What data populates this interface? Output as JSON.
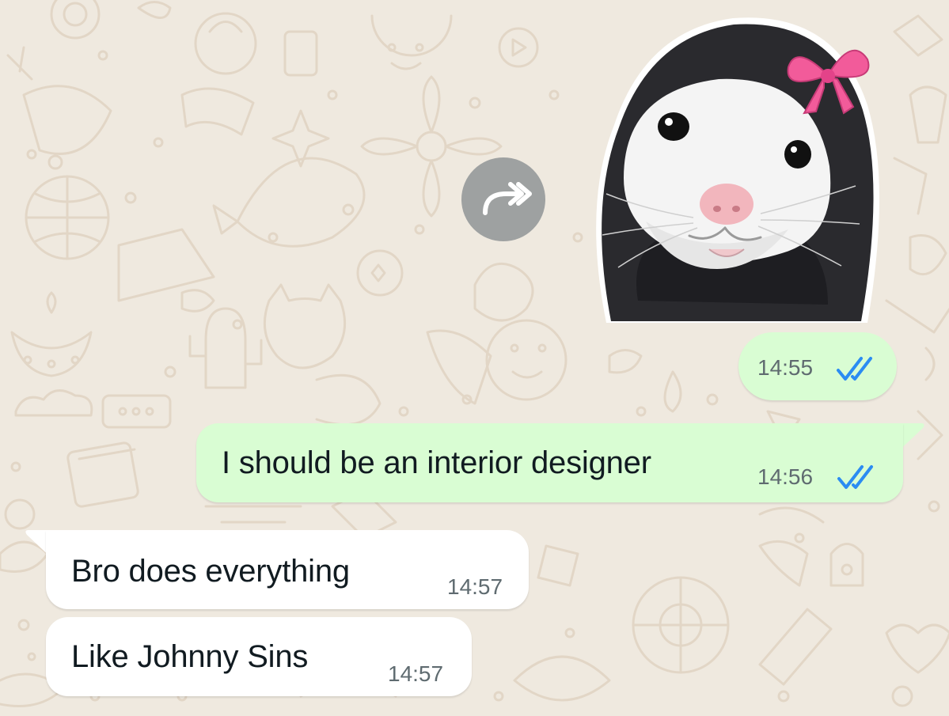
{
  "colors": {
    "wallpaper": "#efe9df",
    "outgoing_bubble": "#d9fdd3",
    "incoming_bubble": "#ffffff",
    "read_ticks": "#2b8cf2",
    "text": "#111b21",
    "timestamp": "#5f6b70"
  },
  "forward_button": {
    "icon": "forward-icon"
  },
  "sticker": {
    "description_icon": "hamster-sticker",
    "time": "14:55",
    "status_icon": "double-check-read-icon"
  },
  "messages": [
    {
      "direction": "outgoing",
      "text": "I should be an interior designer",
      "time": "14:56",
      "status_icon": "double-check-read-icon"
    },
    {
      "direction": "incoming",
      "text": "Bro does everything",
      "time": "14:57"
    },
    {
      "direction": "incoming",
      "text": "Like Johnny Sins",
      "time": "14:57"
    }
  ]
}
